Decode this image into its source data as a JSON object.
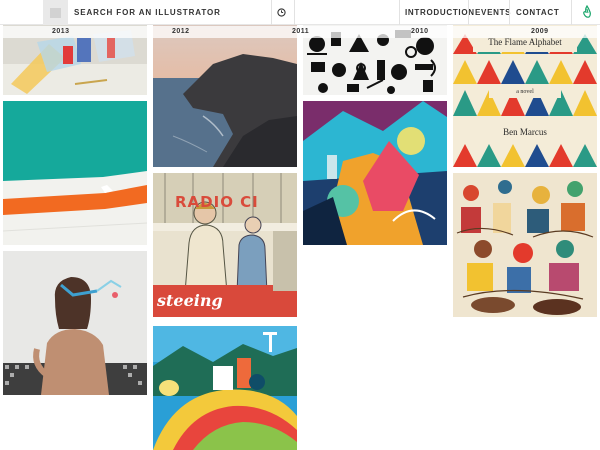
{
  "header": {
    "search_label": "SEARCH FOR AN ILLUSTRATOR",
    "nav": [
      {
        "label": "INTRODUCTION"
      },
      {
        "label": "EVENTS"
      },
      {
        "label": "CONTACT"
      }
    ],
    "icons": {
      "logo": "logo-icon",
      "clock": "clock-icon",
      "hand": "hand-icon"
    }
  },
  "gallery": {
    "years": [
      "2013",
      "2012",
      "2011",
      "2010",
      "2009"
    ],
    "book": {
      "title": "The Flame Alphabet",
      "subtitle": "a novel",
      "author": "Ben Marcus"
    },
    "radio_sign": "RADIO CI",
    "script_word": "steeing"
  },
  "colors": {
    "accent_orange": "#f26a21",
    "teal": "#14a99a",
    "header_text": "#333333"
  }
}
